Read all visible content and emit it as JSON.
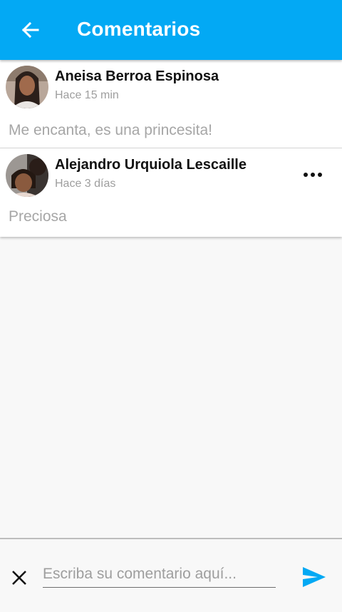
{
  "appbar": {
    "title": "Comentarios",
    "back_icon": "arrow-back-icon",
    "background": "#03a9f4"
  },
  "comments": [
    {
      "author": "Aneisa Berroa Espinosa",
      "time": "Hace 15 min",
      "text": "Me encanta, es una princesita!",
      "avatar_icon": "avatar-photo"
    },
    {
      "author": "Alejandro Urquiola Lescaille",
      "time": "Hace 3 días",
      "text": "Preciosa",
      "avatar_icon": "avatar-photo",
      "more_icon": "more-horizontal-icon"
    }
  ],
  "composer": {
    "placeholder": "Escriba su comentario aquí...",
    "value": "",
    "close_icon": "close-icon",
    "send_icon": "send-icon",
    "accent": "#03a9f4"
  }
}
